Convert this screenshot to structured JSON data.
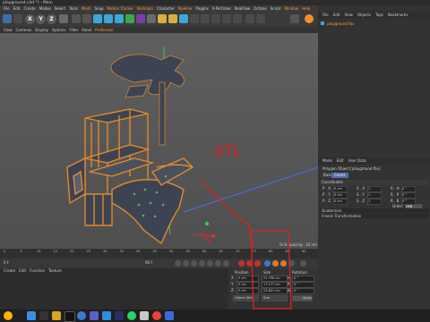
{
  "window": {
    "title": "playground.c4d *] - Main"
  },
  "menubar": {
    "items": [
      "File",
      "Edit",
      "Create",
      "Modes",
      "Select",
      "Tools",
      "Mesh",
      "Snap",
      "Motion Tracker",
      "MoGraph",
      "Character",
      "Pipeline",
      "Plugins",
      "X-Particles",
      "RealFlow",
      "Octane",
      "Script",
      "Window",
      "Help"
    ],
    "highlight": [
      "Mesh",
      "Motion Tracker",
      "MoGraph",
      "Pipeline",
      "Window",
      "Help"
    ]
  },
  "toolbar": {
    "axis": [
      "X",
      "Y",
      "Z"
    ]
  },
  "viewport_menu": {
    "items": [
      "View",
      "Cameras",
      "Display",
      "Options",
      "Filter",
      "Panel",
      "ProRender"
    ],
    "highlight": "ProRender"
  },
  "viewport": {
    "annotation": ".STL",
    "grid_spacing": "Grid Spacing : 10 cm"
  },
  "object_manager": {
    "menu": [
      "File",
      "Edit",
      "View",
      "Objects",
      "Tags",
      "Bookmarks"
    ],
    "object": "playground.fbx"
  },
  "attribute_manager": {
    "menu": [
      "Mode",
      "Edit",
      "User Data"
    ],
    "title": "Polygon Object [playground.fbx]",
    "tabs": [
      "Basic",
      "Coord."
    ],
    "active_tab": "Coord.",
    "section": "Coordinates",
    "rows": [
      {
        "label": "P . X",
        "v1": "0 cm",
        "label2": "S . X",
        "v2": "1",
        "label3": "R . H",
        "v3": "0 °"
      },
      {
        "label": "P . Y",
        "v1": "0 cm",
        "label2": "S . Y",
        "v2": "1",
        "label3": "R . P",
        "v3": "0 °"
      },
      {
        "label": "P . Z",
        "v1": "0 cm",
        "label2": "S . Z",
        "v2": "1",
        "label3": "R . B",
        "v3": "0 °"
      }
    ],
    "order_label": "Order",
    "order_value": "HPB",
    "quaternion": "Quaternion",
    "freeze": "Freeze Transformation"
  },
  "timeline": {
    "ticks": [
      "0",
      "5",
      "10",
      "15",
      "20",
      "25",
      "30",
      "35",
      "40",
      "45",
      "50",
      "55",
      "60",
      "65",
      "70",
      "75",
      "80",
      "85",
      "90"
    ],
    "frame_left": "0 F",
    "frame_right": "90 F"
  },
  "material_manager": {
    "menu": [
      "Create",
      "Edit",
      "Function",
      "Texture"
    ]
  },
  "coordinates_panel": {
    "headers": [
      "Position",
      "Size",
      "Rotation"
    ],
    "rows": [
      {
        "axis": "X",
        "pos": "0 cm",
        "size": "21.796 cm",
        "rot_label": "H",
        "rot": "0 °"
      },
      {
        "axis": "Y",
        "pos": "0 cm",
        "size": "17.177 cm",
        "rot_label": "P",
        "rot": "0 °"
      },
      {
        "axis": "Z",
        "pos": "0 cm",
        "size": "23.821 cm",
        "rot_label": "B",
        "rot": "0 °"
      }
    ],
    "mode1": "Object (Rel)",
    "mode2": "Size",
    "apply": "Apply"
  },
  "colors": {
    "accent": "#ff9a3c",
    "annotation": "#e02020"
  }
}
